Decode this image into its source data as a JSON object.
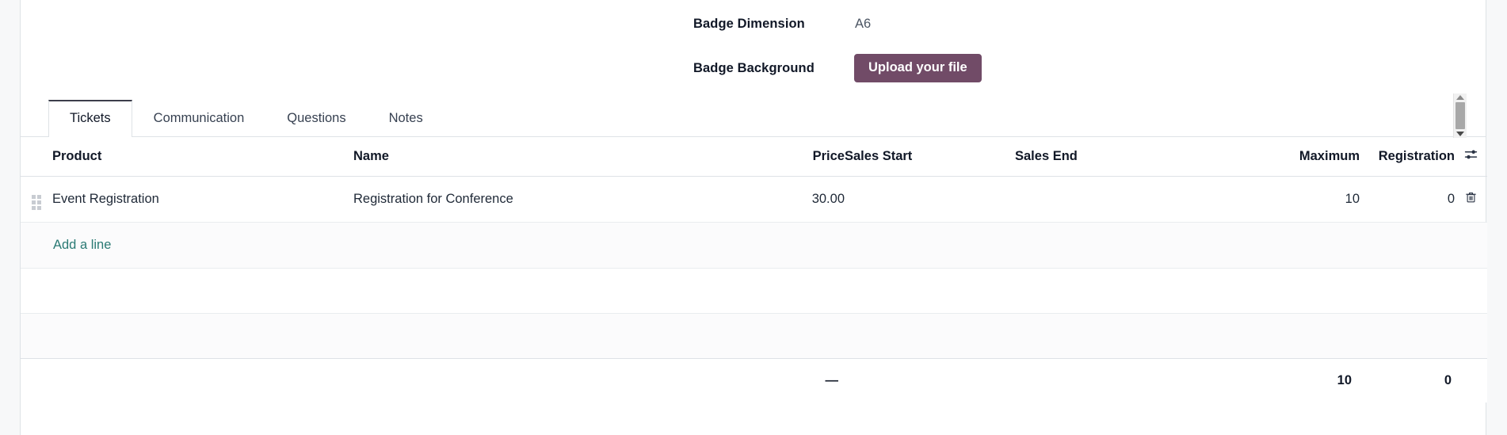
{
  "form": {
    "fields": [
      {
        "label": "Badge Dimension",
        "value": "A6",
        "type": "text"
      },
      {
        "label": "Badge Background",
        "value": "",
        "type": "upload",
        "button_label": "Upload your file"
      }
    ]
  },
  "notebook": {
    "tabs": [
      {
        "label": "Tickets",
        "active": true
      },
      {
        "label": "Communication",
        "active": false
      },
      {
        "label": "Questions",
        "active": false
      },
      {
        "label": "Notes",
        "active": false
      }
    ]
  },
  "table": {
    "columns": [
      {
        "key": "product",
        "label": "Product",
        "align": "left"
      },
      {
        "key": "name",
        "label": "Name",
        "align": "left"
      },
      {
        "key": "price",
        "label": "Price",
        "align": "right"
      },
      {
        "key": "sales_start",
        "label": "Sales Start",
        "align": "left"
      },
      {
        "key": "sales_end",
        "label": "Sales End",
        "align": "left"
      },
      {
        "key": "maximum",
        "label": "Maximum",
        "align": "right"
      },
      {
        "key": "registration",
        "label": "Registration",
        "align": "right"
      }
    ],
    "optional_columns_icon": "sliders-icon",
    "rows": [
      {
        "product": "Event Registration",
        "name": "Registration for Conference",
        "price": "30.00",
        "sales_start": "",
        "sales_end": "",
        "maximum": "10",
        "registration": "0",
        "delete_icon": "trash-icon",
        "handle_icon": "drag-handle-icon"
      }
    ],
    "add_line_label": "Add a line",
    "totals": {
      "price": "—",
      "maximum": "10",
      "registration": "0"
    }
  },
  "scrollbar": {
    "up_icon": "caret-up-icon",
    "down_icon": "caret-down-icon"
  },
  "colors": {
    "accent_button": "#714b67",
    "link": "#2a7a74",
    "border": "#dee2e6",
    "text": "#1f2937"
  }
}
